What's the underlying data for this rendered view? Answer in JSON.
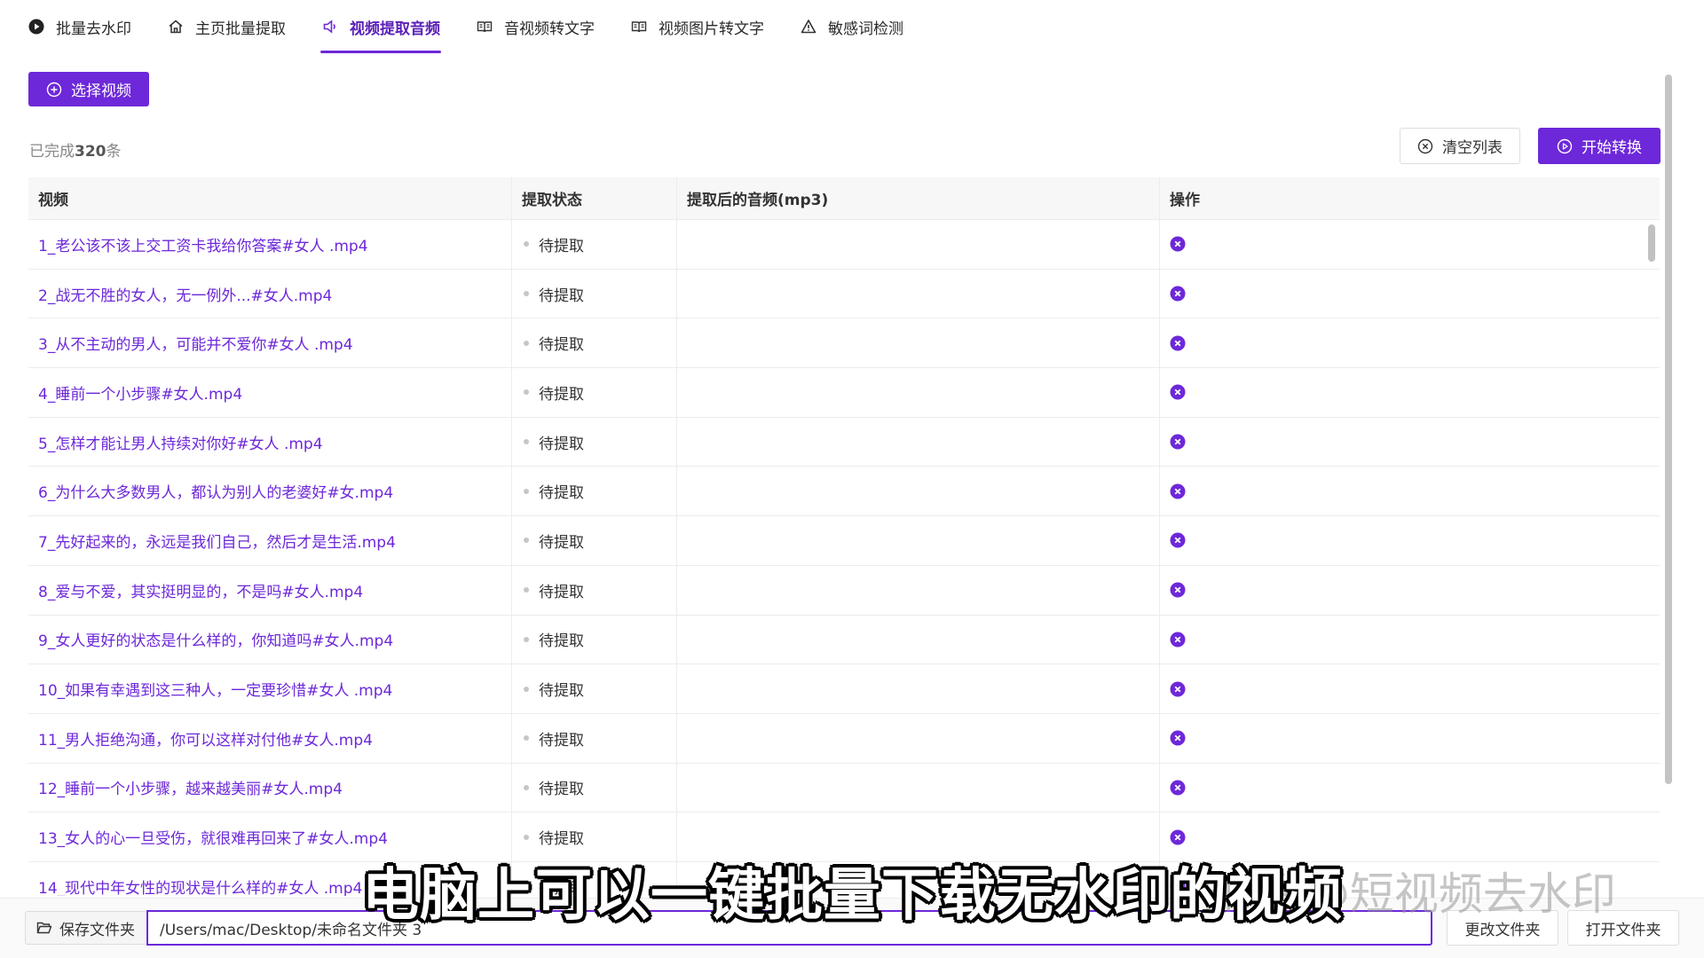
{
  "colors": {
    "accent": "#6d28d9",
    "status_dot": "#c6c6c6"
  },
  "nav": {
    "tabs": [
      {
        "label": "批量去水印",
        "icon": "play-circle-icon"
      },
      {
        "label": "主页批量提取",
        "icon": "home-icon"
      },
      {
        "label": "视频提取音频",
        "icon": "speaker-icon",
        "active": true
      },
      {
        "label": "音视频转文字",
        "icon": "book-icon"
      },
      {
        "label": "视频图片转文字",
        "icon": "book-icon"
      },
      {
        "label": "敏感词检测",
        "icon": "warning-icon"
      }
    ]
  },
  "toolbar": {
    "select_video": "选择视频",
    "done_prefix": "已完成",
    "done_count": "320",
    "done_suffix": "条",
    "clear_list": "清空列表",
    "start_convert": "开始转换"
  },
  "table": {
    "headers": [
      "视频",
      "提取状态",
      "提取后的音频(mp3)",
      "操作"
    ],
    "rows": [
      {
        "video": "1_老公该不该上交工资卡我给你答案#女人 .mp4",
        "status": "待提取",
        "audio": ""
      },
      {
        "video": "2_战无不胜的女人，无一例外...#女人.mp4",
        "status": "待提取",
        "audio": ""
      },
      {
        "video": "3_从不主动的男人，可能并不爱你#女人 .mp4",
        "status": "待提取",
        "audio": ""
      },
      {
        "video": "4_睡前一个小步骤#女人.mp4",
        "status": "待提取",
        "audio": ""
      },
      {
        "video": "5_怎样才能让男人持续对你好#女人 .mp4",
        "status": "待提取",
        "audio": ""
      },
      {
        "video": "6_为什么大多数男人，都认为别人的老婆好#女.mp4",
        "status": "待提取",
        "audio": ""
      },
      {
        "video": "7_先好起来的，永远是我们自己，然后才是生活.mp4",
        "status": "待提取",
        "audio": ""
      },
      {
        "video": "8_爱与不爱，其实挺明显的，不是吗#女人.mp4",
        "status": "待提取",
        "audio": ""
      },
      {
        "video": "9_女人更好的状态是什么样的，你知道吗#女人.mp4",
        "status": "待提取",
        "audio": ""
      },
      {
        "video": "10_如果有幸遇到这三种人，一定要珍惜#女人 .mp4",
        "status": "待提取",
        "audio": ""
      },
      {
        "video": "11_男人拒绝沟通，你可以这样对付他#女人.mp4",
        "status": "待提取",
        "audio": ""
      },
      {
        "video": "12_睡前一个小步骤，越来越美丽#女人.mp4",
        "status": "待提取",
        "audio": ""
      },
      {
        "video": "13_女人的心一旦受伤，就很难再回来了#女人.mp4",
        "status": "待提取",
        "audio": ""
      },
      {
        "video": "14_现代中年女性的现状是什么样的#女人 .mp4",
        "status": "待提取",
        "audio": ""
      }
    ]
  },
  "bottom": {
    "save_folder_label": "保存文件夹",
    "folder_path": "/Users/mac/Desktop/未命名文件夹 3",
    "change_folder": "更改文件夹",
    "open_folder": "打开文件夹"
  },
  "overlay": {
    "subtitle": "电脑上可以一键批量下载无水印的视频",
    "watermark": "知乎 @短视频去水印"
  }
}
